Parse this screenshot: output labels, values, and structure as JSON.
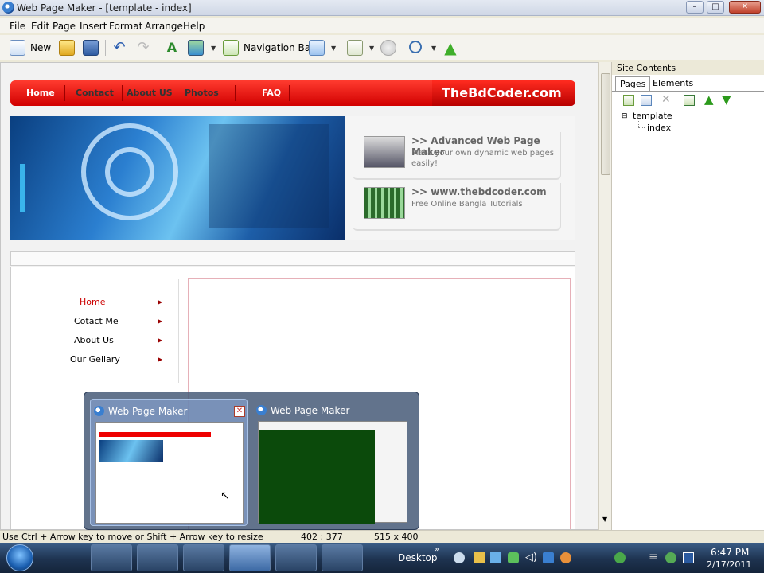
{
  "window": {
    "title": "Web Page Maker - [template - index]"
  },
  "menu": [
    "File",
    "Edit",
    "Page",
    "Insert",
    "Format",
    "Arrange",
    "Help"
  ],
  "toolbar": {
    "new_label": "New",
    "navbar_label": "Navigation Bar"
  },
  "site_contents": {
    "header": "Site Contents",
    "tabs": [
      "Pages",
      "Elements"
    ],
    "tree": {
      "root": "template",
      "child": "index"
    }
  },
  "page": {
    "nav_items": [
      "Home",
      "Contact",
      "About US",
      "Photos",
      "FAQ"
    ],
    "brand": "TheBdCoder.com",
    "promos": [
      {
        "title": ">>  Advanced Web Page Maker",
        "desc": "Make your own dynamic web pages easily!"
      },
      {
        "title": ">>  www.thebdcoder.com",
        "desc": "Free Online Bangla Tutorials"
      }
    ],
    "side_menu": [
      "Home",
      "Cotact Me",
      "About Us",
      "Our Gellary"
    ]
  },
  "peek": {
    "titles": [
      "Web Page Maker",
      "Web Page Maker"
    ]
  },
  "status": {
    "text": "Use Ctrl + Arrow key to move or Shift + Arrow key to resize",
    "coords": "402 : 377",
    "size": "515 x 400"
  },
  "taskbar": {
    "desktop_label": "Desktop",
    "time": "6:47 PM",
    "date": "2/17/2011"
  },
  "colors": {
    "nav_red": "#e60000",
    "link_red": "#cc0000",
    "peek_bg": "#465a78"
  }
}
